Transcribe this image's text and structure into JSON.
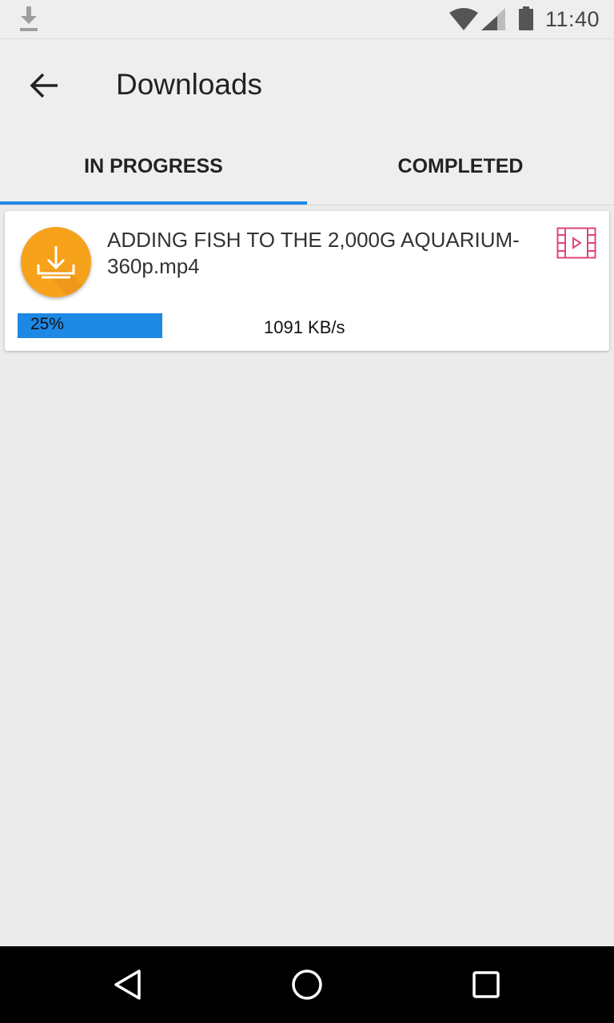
{
  "status_bar": {
    "time": "11:40",
    "icons": [
      "download-notification-icon",
      "wifi-icon",
      "signal-icon",
      "battery-icon"
    ]
  },
  "app_bar": {
    "title": "Downloads",
    "back_icon": "arrow-back-icon"
  },
  "tabs": [
    {
      "label": "IN PROGRESS",
      "active": true
    },
    {
      "label": "COMPLETED",
      "active": false
    }
  ],
  "downloads": [
    {
      "title": "ADDING FISH TO THE 2,000G AQUARIUM-360p.mp4",
      "progress_label": "25%",
      "progress_value": 0.25,
      "speed": "1091 KB/s",
      "thumbnail_icon": "download-tray-icon",
      "type_icon": "video-file-icon"
    }
  ],
  "nav_bar": {
    "icons": [
      "back-triangle-icon",
      "home-circle-icon",
      "recents-square-icon"
    ]
  },
  "colors": {
    "accent": "#1e88e5",
    "avatar": "#f7a21b",
    "video_icon": "#e0457b",
    "background": "#ebebeb"
  }
}
